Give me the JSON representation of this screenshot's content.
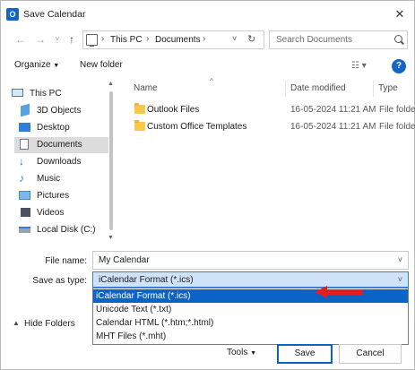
{
  "window": {
    "title": "Save Calendar",
    "app_icon": "outlook-icon"
  },
  "nav": {
    "breadcrumb": [
      "This PC",
      "Documents"
    ],
    "search_placeholder": "Search Documents"
  },
  "toolbar": {
    "organize_label": "Organize",
    "new_folder_label": "New folder",
    "help_label": "?"
  },
  "sidebar": {
    "items": [
      {
        "label": "This PC",
        "icon": "computer-icon"
      },
      {
        "label": "3D Objects",
        "icon": "cube-icon"
      },
      {
        "label": "Desktop",
        "icon": "desktop-icon"
      },
      {
        "label": "Documents",
        "icon": "document-icon",
        "selected": true
      },
      {
        "label": "Downloads",
        "icon": "download-icon"
      },
      {
        "label": "Music",
        "icon": "music-icon"
      },
      {
        "label": "Pictures",
        "icon": "picture-icon"
      },
      {
        "label": "Videos",
        "icon": "video-icon"
      },
      {
        "label": "Local Disk (C:)",
        "icon": "drive-icon"
      }
    ]
  },
  "files": {
    "columns": [
      "Name",
      "Date modified",
      "Type"
    ],
    "rows": [
      {
        "name": "Outlook Files",
        "date": "16-05-2024 11:21 AM",
        "type": "File folder"
      },
      {
        "name": "Custom Office Templates",
        "date": "16-05-2024 11:21 AM",
        "type": "File folder"
      }
    ]
  },
  "form": {
    "file_name_label": "File name:",
    "file_name_value": "My Calendar",
    "save_as_type_label": "Save as type:",
    "save_as_type_value": "iCalendar Format (*.ics)",
    "options": [
      "iCalendar Format (*.ics)",
      "Unicode Text (*.txt)",
      "Calendar HTML (*.htm;*.html)",
      "MHT Files (*.mht)"
    ]
  },
  "footer": {
    "hide_folders_label": "Hide Folders",
    "tools_label": "Tools",
    "save_label": "Save",
    "cancel_label": "Cancel"
  },
  "colors": {
    "accent": "#0a64c8",
    "selection_bg": "#cfe3f8",
    "arrow": "#e02020",
    "folder": "#f7c948"
  }
}
